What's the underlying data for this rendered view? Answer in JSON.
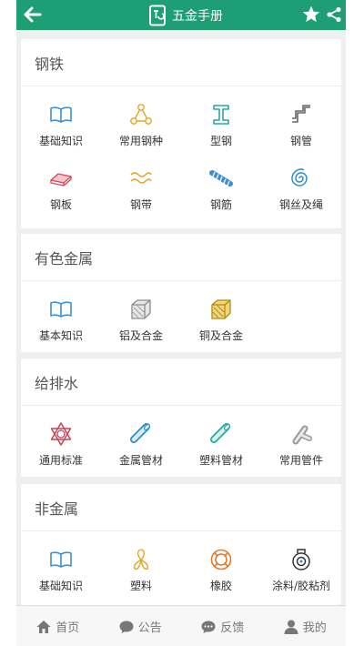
{
  "header": {
    "title": "五金手册",
    "back_icon": "back-arrow-icon",
    "star_icon": "star-icon",
    "share_icon": "share-icon"
  },
  "colors": {
    "brand": "#1e9e74",
    "blue": "#3e8fd0",
    "orange": "#e3a526",
    "teal": "#2aa89a",
    "grey": "#666666",
    "red": "#d9495a"
  },
  "sections": [
    {
      "title": "钢铁",
      "items": [
        {
          "label": "基础知识",
          "icon": "open-book-icon"
        },
        {
          "label": "常用钢种",
          "icon": "triangle-nodes-icon"
        },
        {
          "label": "型钢",
          "icon": "i-beam-icon"
        },
        {
          "label": "钢管",
          "icon": "pipe-bend-icon"
        },
        {
          "label": "钢板",
          "icon": "steel-plate-icon"
        },
        {
          "label": "钢带",
          "icon": "wave-strip-icon"
        },
        {
          "label": "钢筋",
          "icon": "rebar-icon"
        },
        {
          "label": "钢丝及绳",
          "icon": "wire-coil-icon"
        }
      ]
    },
    {
      "title": "有色金属",
      "items": [
        {
          "label": "基本知识",
          "icon": "open-book-icon"
        },
        {
          "label": "铝及合金",
          "icon": "cube-grey-icon"
        },
        {
          "label": "铜及合金",
          "icon": "cube-gold-icon"
        }
      ]
    },
    {
      "title": "给排水",
      "items": [
        {
          "label": "通用标准",
          "icon": "hexagram-icon"
        },
        {
          "label": "金属管材",
          "icon": "metal-pipe-icon"
        },
        {
          "label": "塑料管材",
          "icon": "plastic-pipe-icon"
        },
        {
          "label": "常用管件",
          "icon": "pipe-fitting-icon"
        }
      ]
    },
    {
      "title": "非金属",
      "items": [
        {
          "label": "基础知识",
          "icon": "open-book-icon"
        },
        {
          "label": "塑料",
          "icon": "fan-icon"
        },
        {
          "label": "橡胶",
          "icon": "ring-icon"
        },
        {
          "label": "涂料/胶粘剂",
          "icon": "paint-roll-icon"
        }
      ]
    }
  ],
  "tabs": [
    {
      "label": "首页",
      "icon": "home-icon"
    },
    {
      "label": "公告",
      "icon": "chat-bubble-icon"
    },
    {
      "label": "反馈",
      "icon": "comment-dots-icon"
    },
    {
      "label": "我的",
      "icon": "person-icon"
    }
  ]
}
